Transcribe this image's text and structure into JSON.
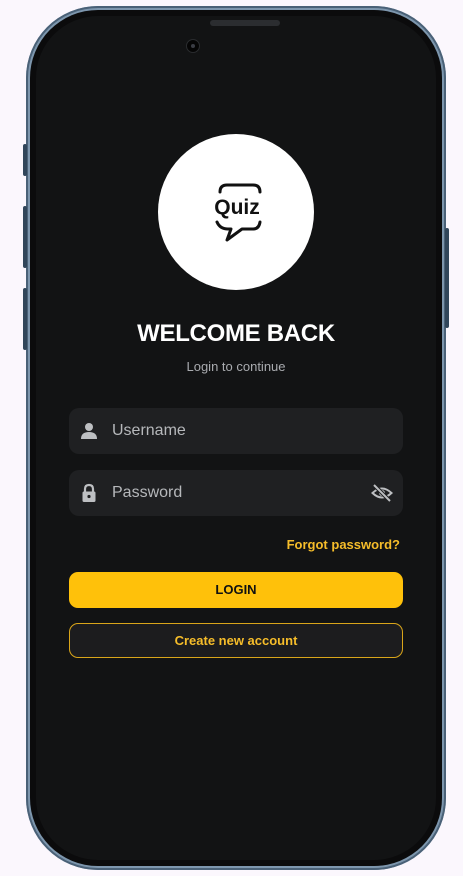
{
  "app": {
    "logo_text": "Quiz"
  },
  "login": {
    "title": "WELCOME BACK",
    "subtitle": "Login to continue",
    "username_placeholder": "Username",
    "password_placeholder": "Password",
    "forgot_password": "Forgot password?",
    "login_button": "LOGIN",
    "create_account_button": "Create new account"
  },
  "icons": {
    "username": "person-icon",
    "password": "lock-icon",
    "toggle_visibility": "eye-off-icon"
  },
  "colors": {
    "background": "#121314",
    "field": "#1f2022",
    "accent": "#ffc10a",
    "text_primary": "#ffffff",
    "text_secondary": "#a9abaf"
  }
}
